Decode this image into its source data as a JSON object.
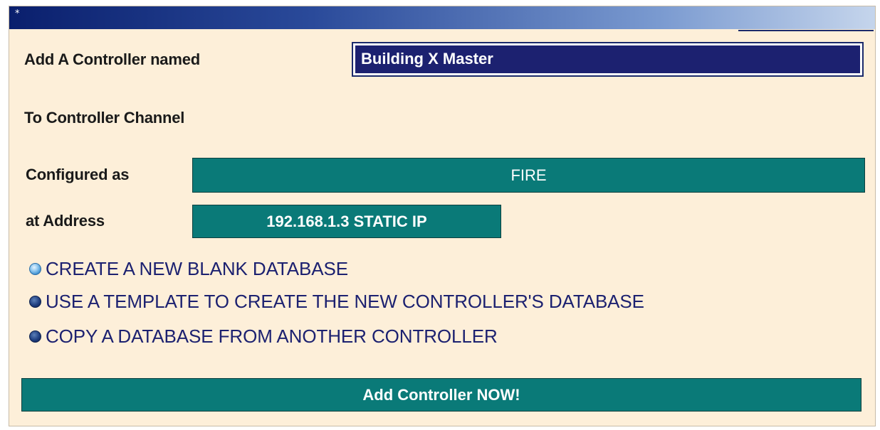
{
  "window": {
    "title_glyph": "*"
  },
  "form": {
    "name_label": "Add A Controller named",
    "name_value": "Building X Master",
    "channel_label": "To Controller Channel",
    "configured_label": "Configured as",
    "configured_value": "FIRE",
    "address_label": "at Address",
    "address_value": "192.168.1.3  STATIC IP"
  },
  "options": [
    {
      "label": "CREATE A NEW BLANK DATABASE",
      "selected": true
    },
    {
      "label": "USE A TEMPLATE TO CREATE THE NEW CONTROLLER'S DATABASE",
      "selected": false
    },
    {
      "label": "COPY A DATABASE FROM ANOTHER CONTROLLER",
      "selected": false
    }
  ],
  "actions": {
    "add_button_label": "Add Controller NOW!"
  },
  "colors": {
    "background": "#fdefd9",
    "field_navy": "#1c2170",
    "teal": "#0a7a78",
    "option_text": "#1c2170"
  }
}
